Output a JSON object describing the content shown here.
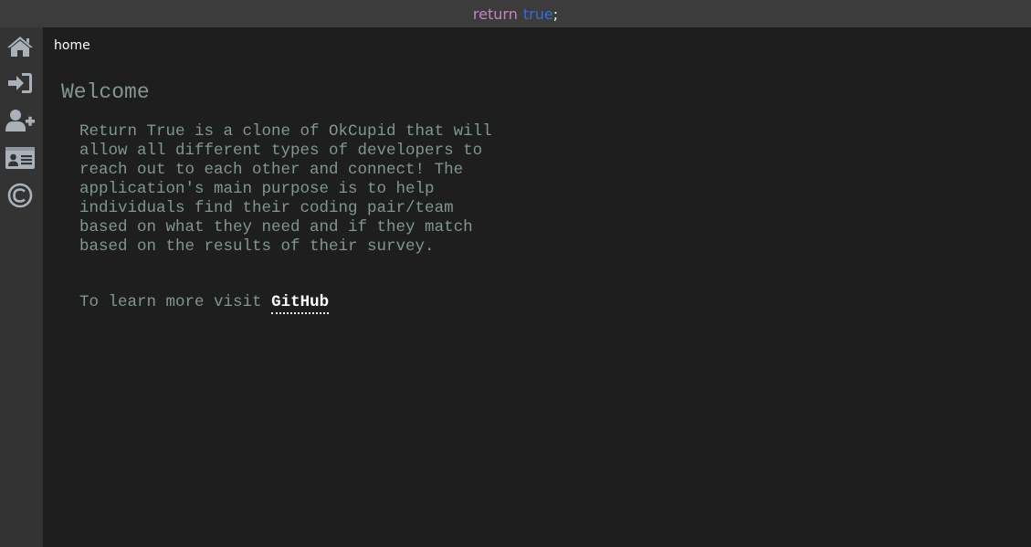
{
  "topbar": {
    "return_kw": "return",
    "true_kw": "true",
    "semicolon": ";"
  },
  "sidebar": {
    "items": [
      {
        "icon": "home-icon"
      },
      {
        "icon": "sign-in-icon"
      },
      {
        "icon": "user-plus-icon"
      },
      {
        "icon": "id-card-icon"
      },
      {
        "icon": "copyright-icon"
      }
    ]
  },
  "main": {
    "breadcrumb": "home",
    "title": "Welcome",
    "description": "Return True is a clone of OkCupid that will allow all different types of developers to reach out to each other and connect! The application's main purpose is to help individuals find their coding pair/team based on what they need and if they match based on the results of their survey.",
    "learn_more_prefix": "To learn more visit",
    "learn_more_link": "GitHub"
  },
  "colors": {
    "topbar_bg": "#3c3c3c",
    "sidebar_bg": "#333333",
    "main_bg": "#1e1e1e",
    "text": "#7f9693",
    "keyword_return": "#c586c0",
    "keyword_true": "#2f6fd6"
  }
}
